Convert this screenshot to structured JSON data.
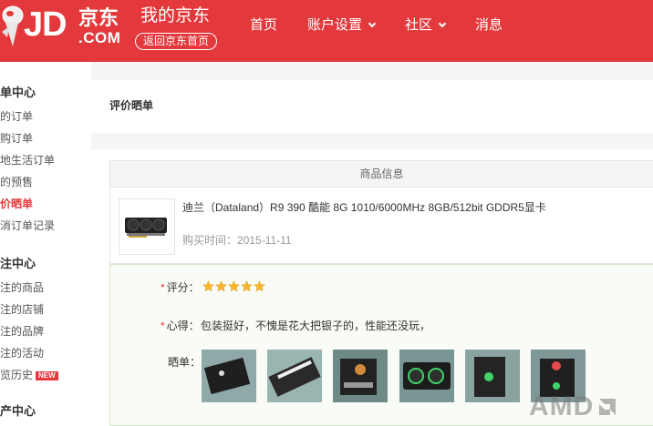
{
  "header": {
    "logo_jd": "JD",
    "logo_cn": "京东",
    "logo_com": ".COM",
    "site_title": "我的京东",
    "back_home": "返回京东首页",
    "nav": [
      {
        "label": "首页",
        "has_dropdown": false
      },
      {
        "label": "账户设置",
        "has_dropdown": true
      },
      {
        "label": "社区",
        "has_dropdown": true
      },
      {
        "label": "消息",
        "has_dropdown": false
      }
    ]
  },
  "sidebar": {
    "groups": [
      {
        "title": "订单中心",
        "visible_title": "单中心",
        "items": [
          "的订单",
          "购订单",
          "地生活订单",
          "的预售",
          "价晒单",
          "消订单记录"
        ],
        "active": "价晒单"
      },
      {
        "title": "关注中心",
        "visible_title": "注中心",
        "items": [
          "注的商品",
          "注的店铺",
          "注的品牌",
          "注的活动",
          "览历史"
        ],
        "badge": "NEW"
      },
      {
        "title": "资产中心",
        "visible_title": "产中心"
      }
    ]
  },
  "main": {
    "page_title": "评价晒单",
    "product_section_header": "商品信息",
    "product": {
      "name": "迪兰（Dataland）R9 390 酷能 8G 1010/6000MHz 8GB/512bit GDDR5显卡",
      "buy_time": "购买时间：2015-11-11"
    },
    "review": {
      "rating_label": "评分：",
      "rating_value": 5,
      "rating_max": 5,
      "comment_label": "心得：",
      "comment_text": "包装挺好，不愧是花大把银子的，性能还没玩，",
      "photos_label": "晒单：",
      "photos": [
        "photo-1",
        "photo-2",
        "photo-3",
        "photo-4",
        "photo-5",
        "photo-6"
      ]
    },
    "watermark": "AMD"
  },
  "colors": {
    "brand_red": "#e4393c",
    "star_gold": "#f7b52c",
    "review_bg": "#f9fcf6"
  }
}
